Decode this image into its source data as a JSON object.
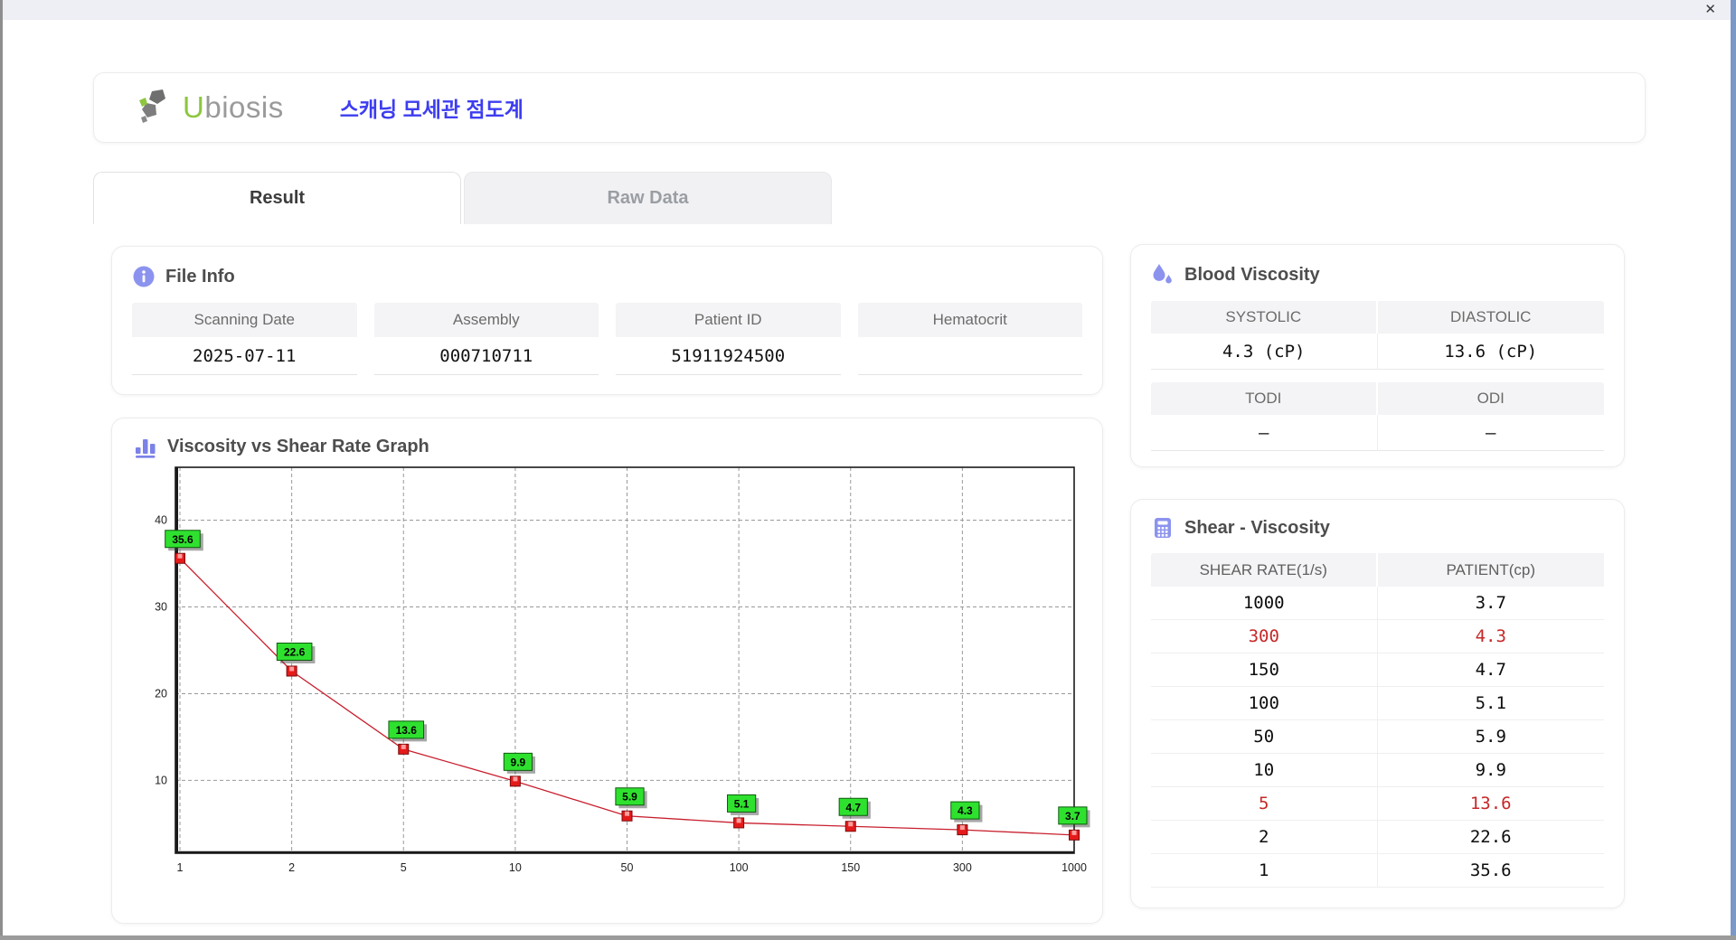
{
  "window": {
    "close_glyph": "✕"
  },
  "header": {
    "logo_u": "U",
    "logo_rest": "biosis",
    "app_title": "스캐닝 모세관 점도계"
  },
  "tabs": [
    {
      "label": "Result",
      "active": true
    },
    {
      "label": "Raw Data",
      "active": false
    }
  ],
  "file_info": {
    "title": "File Info",
    "fields": [
      {
        "label": "Scanning Date",
        "value": "2025-07-11"
      },
      {
        "label": "Assembly",
        "value": "000710711"
      },
      {
        "label": "Patient ID",
        "value": "51911924500"
      },
      {
        "label": "Hematocrit",
        "value": ""
      }
    ]
  },
  "blood_viscosity": {
    "title": "Blood Viscosity",
    "metrics": [
      {
        "label": "SYSTOLIC",
        "value": "4.3 (cP)"
      },
      {
        "label": "DIASTOLIC",
        "value": "13.6 (cP)"
      },
      {
        "label": "TODI",
        "value": "–"
      },
      {
        "label": "ODI",
        "value": "–"
      }
    ]
  },
  "graph": {
    "title": "Viscosity vs Shear Rate Graph"
  },
  "chart_data": {
    "type": "line",
    "title": "Viscosity vs Shear Rate Graph",
    "x_categories": [
      "1",
      "2",
      "5",
      "10",
      "50",
      "100",
      "150",
      "300",
      "1000"
    ],
    "x_scale": "categorical (log-spaced shear rates, equally spaced on axis)",
    "series": [
      {
        "name": "Patient viscosity (cP)",
        "values": [
          35.6,
          22.6,
          13.6,
          9.9,
          5.9,
          5.1,
          4.7,
          4.3,
          3.7
        ]
      }
    ],
    "point_labels_visible": true,
    "y_ticks": [
      10,
      20,
      30,
      40
    ],
    "ylim": [
      1.6,
      46.1
    ],
    "xlabel": "",
    "ylabel": "",
    "grid": "dashed",
    "legend": "none",
    "colors": {
      "line": "#c81f2e",
      "marker": "#e51a1a",
      "marker_border": "#7c0b0b",
      "marker_notch": "#ff9d9d",
      "label_bg": "#2fe12f",
      "label_border": "#0a5a0a",
      "grid": "#999999",
      "frame": "#1a1a1a"
    }
  },
  "shear_table": {
    "title": "Shear - Viscosity",
    "columns": [
      "SHEAR RATE(1/s)",
      "PATIENT(cp)"
    ],
    "rows": [
      {
        "rate": "1000",
        "value": "3.7",
        "alert": false
      },
      {
        "rate": "300",
        "value": "4.3",
        "alert": true
      },
      {
        "rate": "150",
        "value": "4.7",
        "alert": false
      },
      {
        "rate": "100",
        "value": "5.1",
        "alert": false
      },
      {
        "rate": "50",
        "value": "5.9",
        "alert": false
      },
      {
        "rate": "10",
        "value": "9.9",
        "alert": false
      },
      {
        "rate": "5",
        "value": "13.6",
        "alert": true
      },
      {
        "rate": "2",
        "value": "22.6",
        "alert": false
      },
      {
        "rate": "1",
        "value": "35.6",
        "alert": false
      }
    ]
  }
}
